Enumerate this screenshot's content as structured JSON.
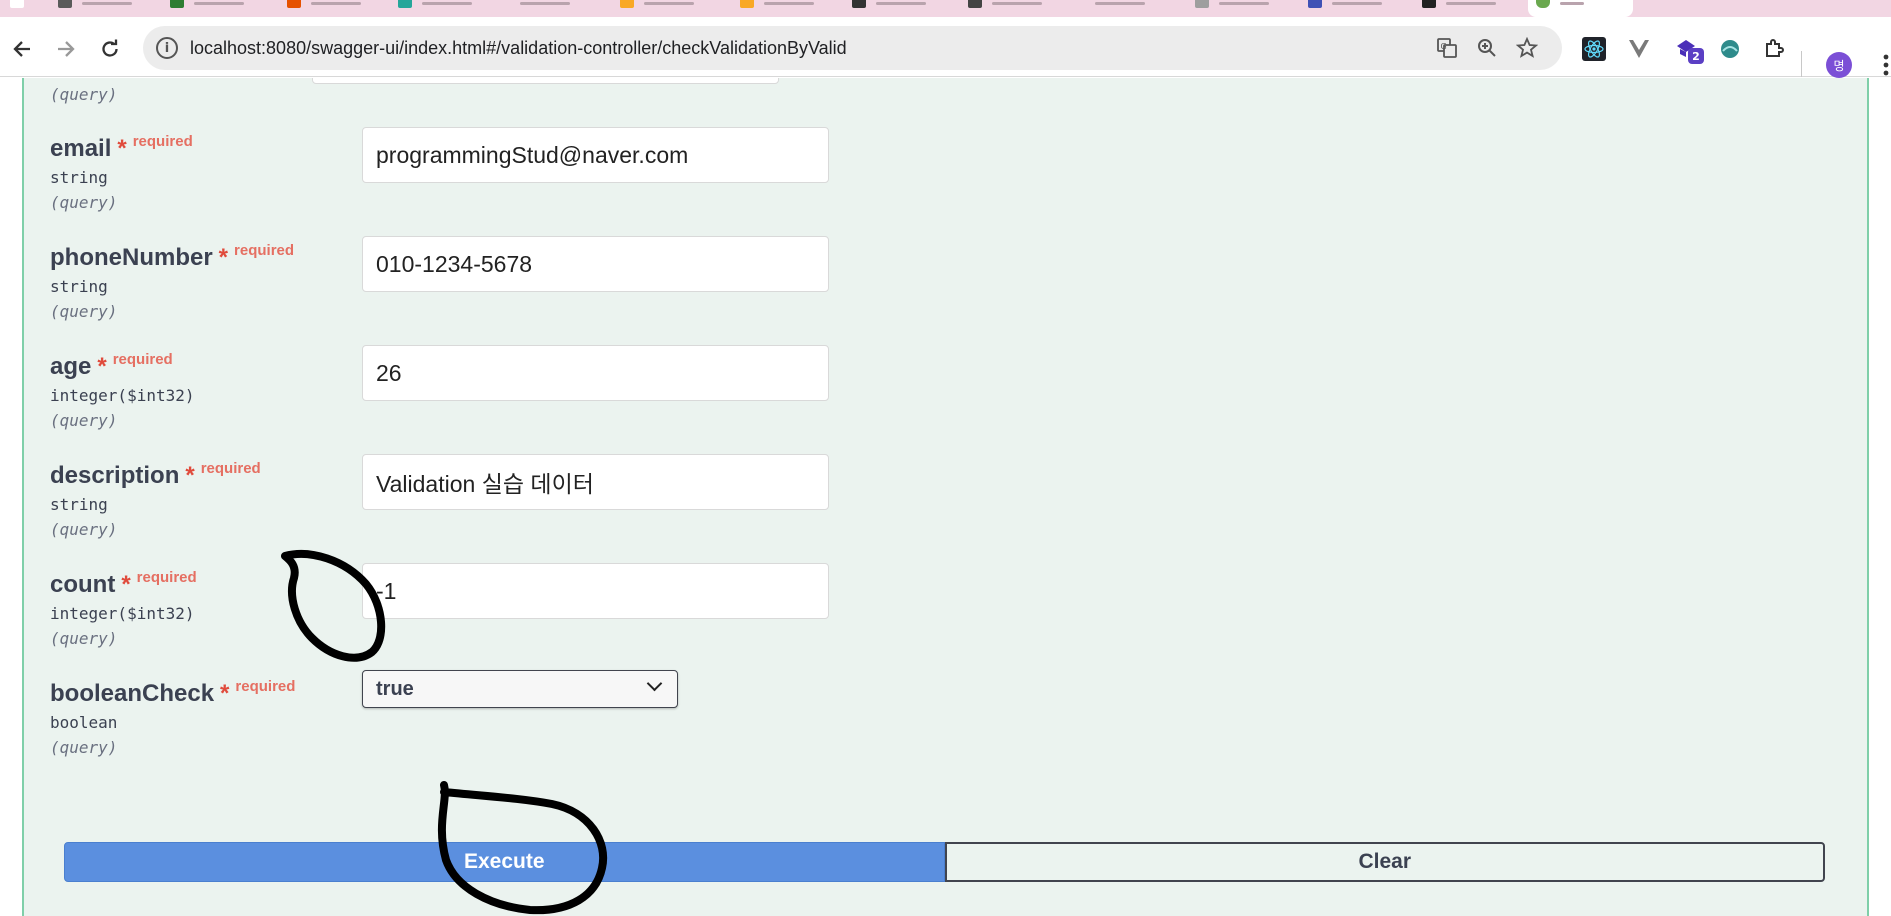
{
  "browser": {
    "url": "localhost:8080/swagger-ui/index.html#/validation-controller/checkValidationByValid",
    "nav_back_icon": "arrow-left-icon",
    "nav_forward_icon": "arrow-right-icon",
    "reload_icon": "reload-icon",
    "profile_initial": "명",
    "extension_badge": "2",
    "accent_color": "#7b4fd6"
  },
  "params": [
    {
      "name": "email",
      "star": "*",
      "required_label": "required",
      "type": "string",
      "in": "(query)",
      "value": "programmingStud@naver.com"
    },
    {
      "name": "phoneNumber",
      "star": "*",
      "required_label": "required",
      "type": "string",
      "in": "(query)",
      "value": "010-1234-5678"
    },
    {
      "name": "age",
      "star": "*",
      "required_label": "required",
      "type": "integer($int32)",
      "in": "(query)",
      "value": "26"
    },
    {
      "name": "description",
      "star": "*",
      "required_label": "required",
      "type": "string",
      "in": "(query)",
      "value": "Validation 실습 데이터"
    },
    {
      "name": "count",
      "star": "*",
      "required_label": "required",
      "type": "integer($int32)",
      "in": "(query)",
      "value": "-1"
    },
    {
      "name": "booleanCheck",
      "star": "*",
      "required_label": "required",
      "type": "boolean",
      "in": "(query)",
      "value": "true"
    }
  ],
  "partial_param_in": "(query)",
  "actions": {
    "execute_label": "Execute",
    "clear_label": "Clear"
  },
  "colors": {
    "execute_bg": "#5b8fdf",
    "opblock_bg": "#ebf3ef",
    "opblock_border": "#7fcfa9",
    "required": "#e56f62"
  }
}
